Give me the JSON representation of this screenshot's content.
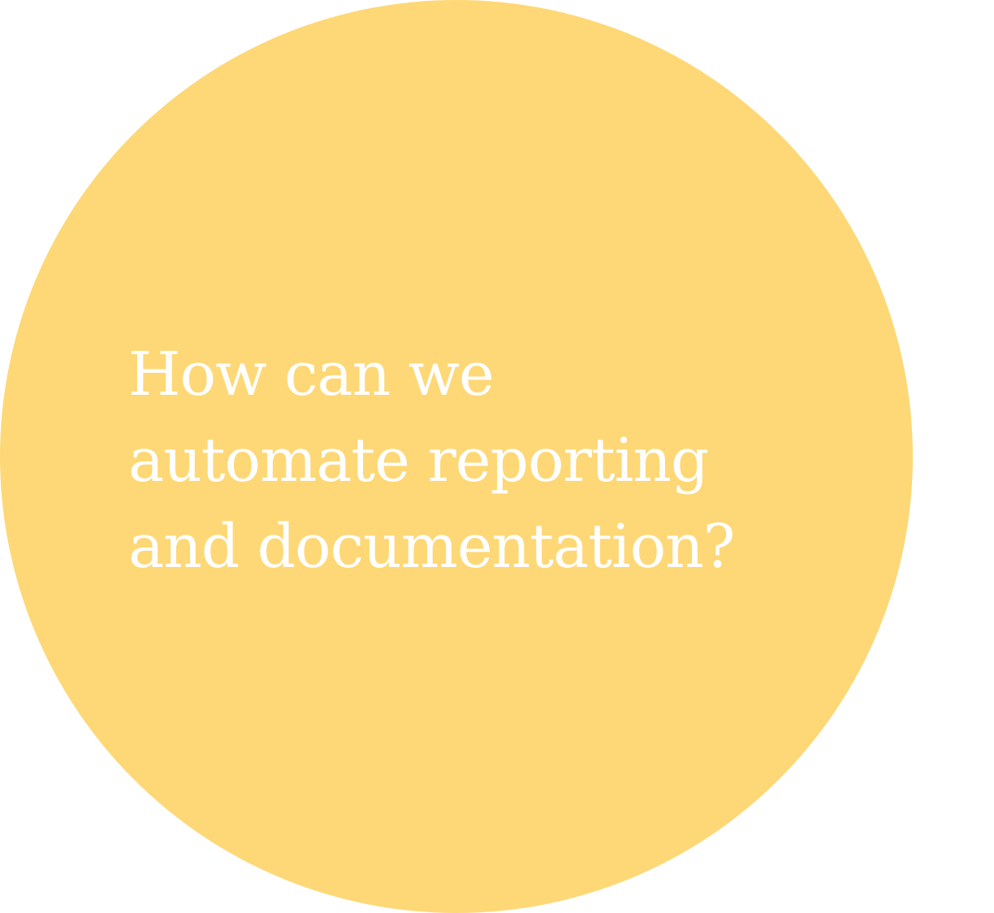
{
  "colors": {
    "circle": "#FED876",
    "text": "#FFFFFF",
    "background": "#FFFFFF"
  },
  "question": {
    "lines": [
      "How can we",
      "automate reporting",
      "and documentation?"
    ]
  }
}
